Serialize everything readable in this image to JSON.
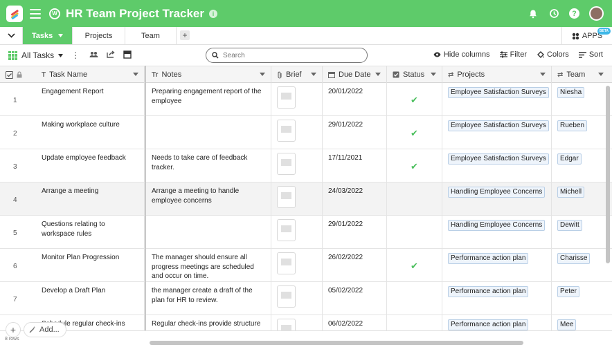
{
  "app": {
    "title": "HR Team Project Tracker",
    "info_icon": "i",
    "workspace_icon": "W"
  },
  "tabs": [
    {
      "label": "Tasks",
      "active": true
    },
    {
      "label": "Projects",
      "active": false
    },
    {
      "label": "Team",
      "active": false
    }
  ],
  "tab_add_label": "+",
  "apps": {
    "label": "APPS",
    "badge": "BETA"
  },
  "view": {
    "label": "All Tasks"
  },
  "search": {
    "placeholder": "Search",
    "value": ""
  },
  "tools": {
    "hide_columns": "Hide columns",
    "filter": "Filter",
    "colors": "Colors",
    "sort": "Sort"
  },
  "columns": {
    "task_name": "Task Name",
    "notes": "Notes",
    "brief": "Brief",
    "due_date": "Due Date",
    "status": "Status",
    "projects": "Projects",
    "team": "Team"
  },
  "rows": [
    {
      "num": "1",
      "task": "Engagement Report",
      "notes": "Preparing engagement report of the employee",
      "due": "20/01/2022",
      "status": true,
      "project": "Employee Satisfaction Surveys",
      "team": "Niesha"
    },
    {
      "num": "2",
      "task": "Making workplace culture",
      "notes": "",
      "due": "29/01/2022",
      "status": true,
      "project": "Employee Satisfaction Surveys",
      "team": "Rueben"
    },
    {
      "num": "3",
      "task": "Update employee feedback",
      "notes": "Needs to take care of feedback tracker.",
      "due": "17/11/2021",
      "status": true,
      "project": "Employee Satisfaction Surveys",
      "team": "Edgar"
    },
    {
      "num": "4",
      "task": "Arrange a meeting",
      "notes": "Arrange a meeting to handle employee concerns",
      "due": "24/03/2022",
      "status": false,
      "project": "Handling Employee Concerns",
      "team": "Michell"
    },
    {
      "num": "5",
      "task": "Questions relating to workspace rules",
      "notes": "",
      "due": "29/01/2022",
      "status": false,
      "project": "Handling Employee Concerns",
      "team": "Dewitt"
    },
    {
      "num": "6",
      "task": "Monitor Plan Progression",
      "notes": "The manager should ensure all progress meetings are scheduled and occur on time.",
      "due": "26/02/2022",
      "status": true,
      "project": "Performance action plan",
      "team": "Charisse"
    },
    {
      "num": "7",
      "task": "Develop a Draft Plan",
      "notes": "the manager create a draft of the plan for HR to review.",
      "due": "05/02/2022",
      "status": false,
      "project": "Performance action plan",
      "team": "Peter"
    },
    {
      "num": "8",
      "task": "Schedule regular check-ins",
      "notes": "Regular check-ins provide structure",
      "due": "06/02/2022",
      "status": false,
      "project": "Performance action plan",
      "team": "Mee"
    }
  ],
  "footer": {
    "add_label": "Add...",
    "row_count": "8 rows"
  },
  "colors": {
    "brand": "#5ecb6a",
    "check": "#4cbf5e",
    "chip_bg": "#eef4fb",
    "chip_border": "#b9cfe6"
  }
}
